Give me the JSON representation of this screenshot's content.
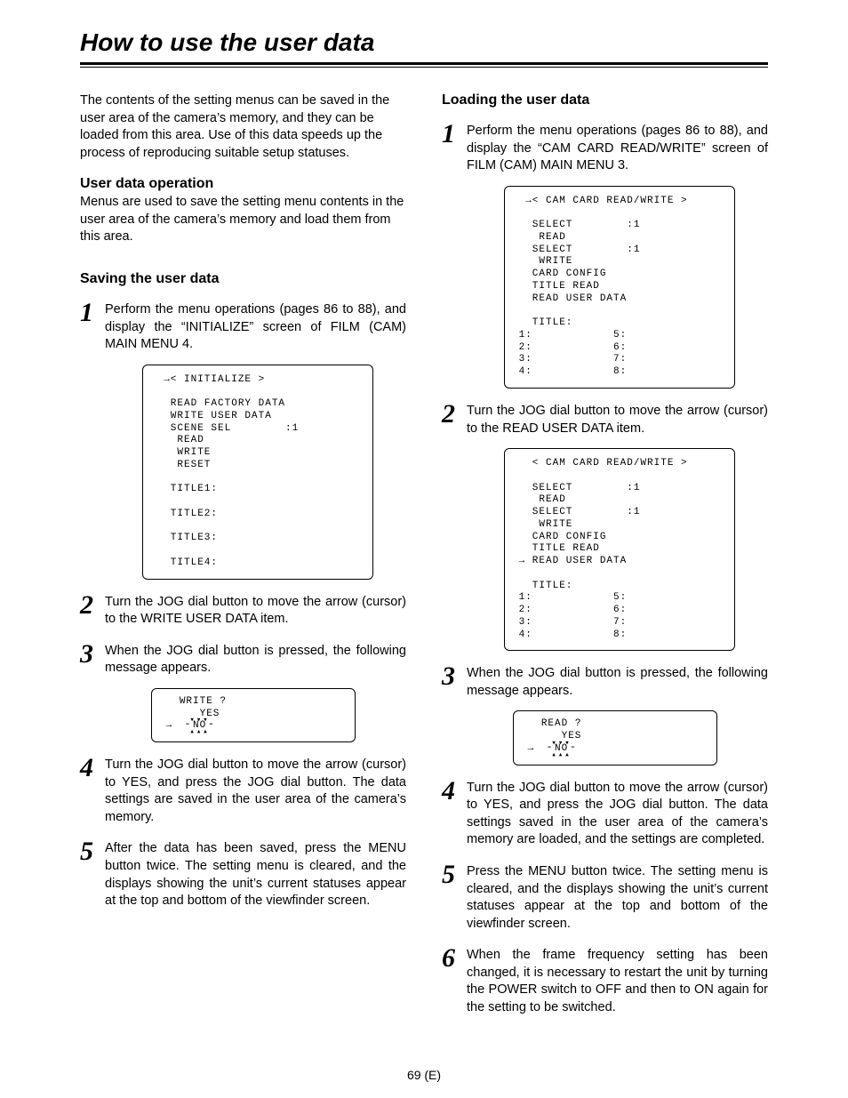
{
  "title": "How to use the user data",
  "intro": "The contents of the setting menus can be saved in the user area of the camera’s memory, and they can be loaded from this area.  Use of this data speeds up the process of reproducing suitable setup statuses.",
  "left": {
    "h_userdata": "User data operation",
    "userdata_text": "Menus are used to save the setting menu contents in the user area of the camera’s memory and load them from this area.",
    "h_saving": "Saving the user data",
    "step1": "Perform the menu operations (pages 86 to 88), and display the “INITIALIZE” screen of FILM (CAM) MAIN MENU 4.",
    "screen1": "  →< INITIALIZE >\n\n   READ FACTORY DATA\n   WRITE USER DATA\n   SCENE SEL        :1\n    READ\n    WRITE\n    RESET\n\n   TITLE1:\n\n   TITLE2:\n\n   TITLE3:\n\n   TITLE4:",
    "step2": "Turn the JOG dial button to move the arrow (cursor) to the WRITE USER DATA item.",
    "step3": "When the JOG dial button is pressed, the following message appears.",
    "screen3_label": "WRITE ?",
    "screen3_yes": "YES",
    "screen3_no": "NO",
    "step4": "Turn the JOG dial button to move the arrow (cursor) to YES, and press the JOG dial button.\nThe data settings are saved in the user area of the camera’s memory.",
    "step5": "After the data has been saved, press the MENU button twice.\nThe setting menu is cleared, and the displays showing the unit’s current statuses appear at the top and bottom of the viewfinder screen."
  },
  "right": {
    "h_loading": "Loading the user data",
    "step1": "Perform the menu operations (pages 86 to 88), and display the “CAM CARD READ/WRITE” screen of FILM (CAM) MAIN MENU 3.",
    "screen1": "  →< CAM CARD READ/WRITE >\n\n   SELECT        :1\n    READ\n   SELECT        :1\n    WRITE\n   CARD CONFIG\n   TITLE READ\n   READ USER DATA\n\n   TITLE:\n 1:            5:\n 2:            6:\n 3:            7:\n 4:            8:",
    "step2": "Turn the JOG dial button to move the arrow (cursor) to the READ USER DATA item.",
    "screen2": "   < CAM CARD READ/WRITE >\n\n   SELECT        :1\n    READ\n   SELECT        :1\n    WRITE\n   CARD CONFIG\n   TITLE READ\n → READ USER DATA\n\n   TITLE:\n 1:            5:\n 2:            6:\n 3:            7:\n 4:            8:",
    "step3": "When the JOG dial button is pressed, the following message appears.",
    "screen3_label": "READ ?",
    "screen3_yes": "YES",
    "screen3_no": "NO",
    "step4": "Turn the JOG dial button to move the arrow (cursor) to YES, and press the JOG dial button.\nThe data settings saved in the user area of the camera’s memory are loaded, and the settings are completed.",
    "step5": "Press the MENU button twice.\nThe setting menu is cleared, and the displays showing the unit’s current statuses appear at the top and bottom of the viewfinder screen.",
    "step6": "When the frame frequency setting has been changed, it is necessary to restart the unit by turning the POWER switch to OFF and then to ON again for the setting to be switched."
  },
  "page_number": "69 (E)"
}
